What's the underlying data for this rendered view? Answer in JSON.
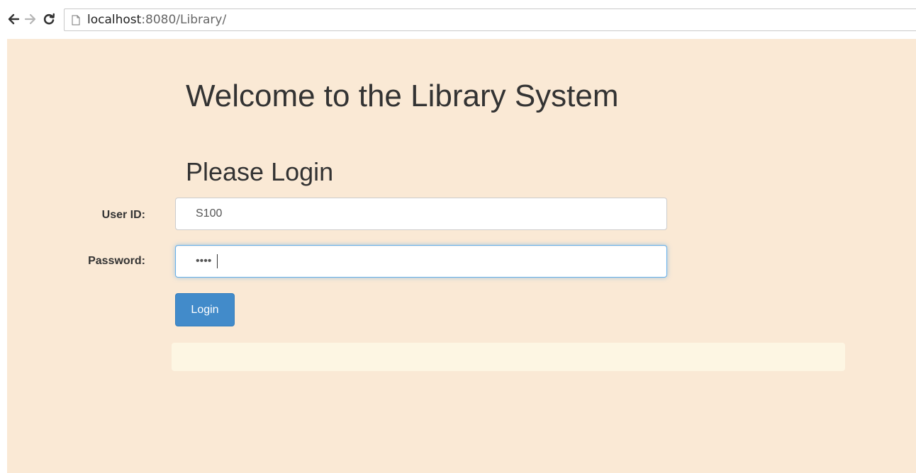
{
  "browser": {
    "url_host": "localhost",
    "url_rest": ":8080/Library/"
  },
  "page": {
    "title": "Welcome to the Library System",
    "subtitle": "Please Login",
    "background_color": "#fae9d5"
  },
  "form": {
    "userid_label": "User ID:",
    "userid_value": "S100",
    "password_label": "Password:",
    "password_value": "••••",
    "login_label": "Login"
  },
  "colors": {
    "button": "#428bca",
    "message_box": "#fdf6e3"
  }
}
